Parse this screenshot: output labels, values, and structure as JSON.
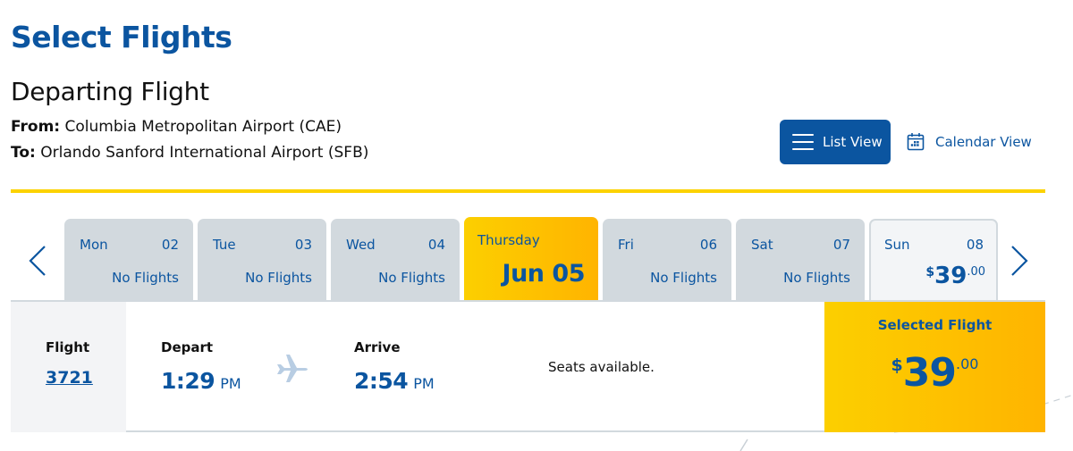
{
  "header": {
    "title": "Select Flights",
    "section_title": "Departing Flight",
    "from_label": "From:",
    "from_value": "Columbia Metropolitan Airport (CAE)",
    "to_label": "To:",
    "to_value": "Orlando Sanford International Airport (SFB)"
  },
  "view_toggle": {
    "list_view_label": "List View",
    "calendar_view_label": "Calendar View",
    "active": "List View"
  },
  "date_nav": {
    "prev_icon": "chevron-left-icon",
    "next_icon": "chevron-right-icon",
    "days": [
      {
        "name": "Mon",
        "num": "02",
        "status": "No Flights"
      },
      {
        "name": "Tue",
        "num": "03",
        "status": "No Flights"
      },
      {
        "name": "Wed",
        "num": "04",
        "status": "No Flights"
      },
      {
        "name": "Thursday",
        "date": "Jun 05",
        "selected": true
      },
      {
        "name": "Fri",
        "num": "06",
        "status": "No Flights"
      },
      {
        "name": "Sat",
        "num": "07",
        "status": "No Flights"
      },
      {
        "name": "Sun",
        "num": "08",
        "price_currency": "$",
        "price_whole": "39",
        "price_cents": ".00"
      }
    ]
  },
  "flight": {
    "flight_label": "Flight",
    "flight_number": "3721",
    "depart_label": "Depart",
    "depart_time": "1:29",
    "depart_ampm": "PM",
    "arrive_label": "Arrive",
    "arrive_time": "2:54",
    "arrive_ampm": "PM",
    "seats_text": "Seats available.",
    "selected_label": "Selected Flight",
    "price_currency": "$",
    "price_whole": "39",
    "price_cents": ".00"
  },
  "colors": {
    "brand_blue": "#0b55a0",
    "accent_yellow": "#fcd200",
    "accent_orange": "#ffb400",
    "tab_gray": "#d2d9de"
  }
}
